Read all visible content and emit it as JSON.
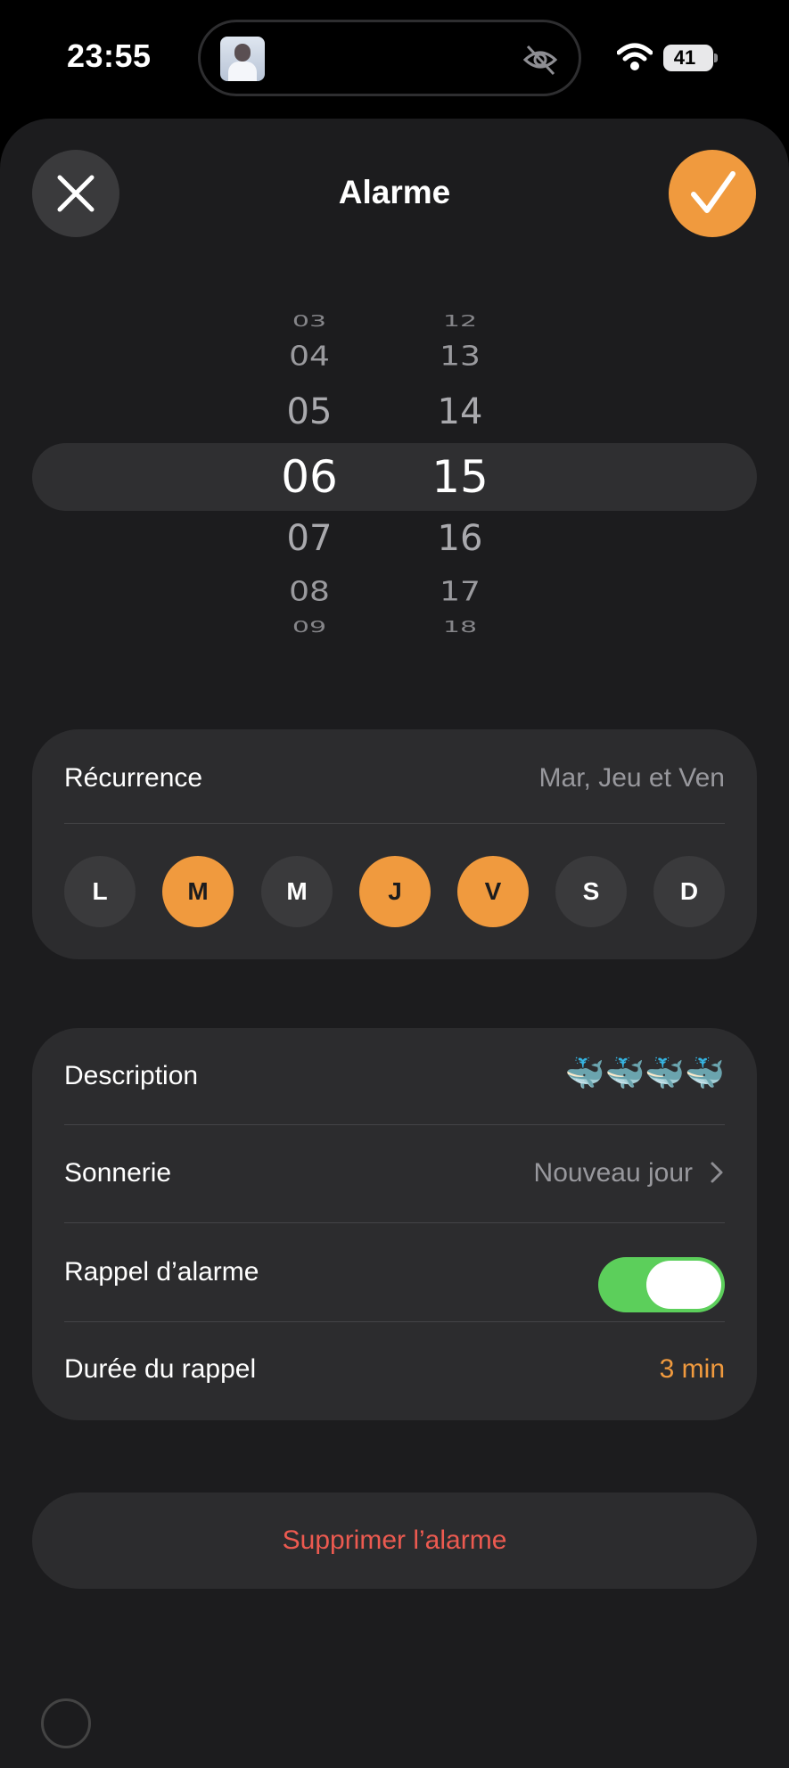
{
  "status": {
    "time": "23:55",
    "battery": "41"
  },
  "header": {
    "title": "Alarme"
  },
  "picker": {
    "hours": [
      "03",
      "04",
      "05",
      "06",
      "07",
      "08",
      "09"
    ],
    "minutes": [
      "12",
      "13",
      "14",
      "15",
      "16",
      "17",
      "18"
    ],
    "selected_hour": "06",
    "selected_minute": "15"
  },
  "recurrence": {
    "label": "Récurrence",
    "value": "Mar, Jeu et Ven",
    "days": [
      {
        "letter": "L",
        "on": false
      },
      {
        "letter": "M",
        "on": true
      },
      {
        "letter": "M",
        "on": false
      },
      {
        "letter": "J",
        "on": true
      },
      {
        "letter": "V",
        "on": true
      },
      {
        "letter": "S",
        "on": false
      },
      {
        "letter": "D",
        "on": false
      }
    ]
  },
  "settings": {
    "description_label": "Description",
    "description_value": "🐳🐳🐳🐳",
    "ringtone_label": "Sonnerie",
    "ringtone_value": "Nouveau jour",
    "snooze_label": "Rappel d’alarme",
    "snooze_on": true,
    "snooze_duration_label": "Durée du rappel",
    "snooze_duration_value": "3 min"
  },
  "delete_label": "Supprimer l’alarme",
  "colors": {
    "accent": "#f09a3e",
    "toggle": "#5ccf5b",
    "danger": "#ec5a50"
  }
}
